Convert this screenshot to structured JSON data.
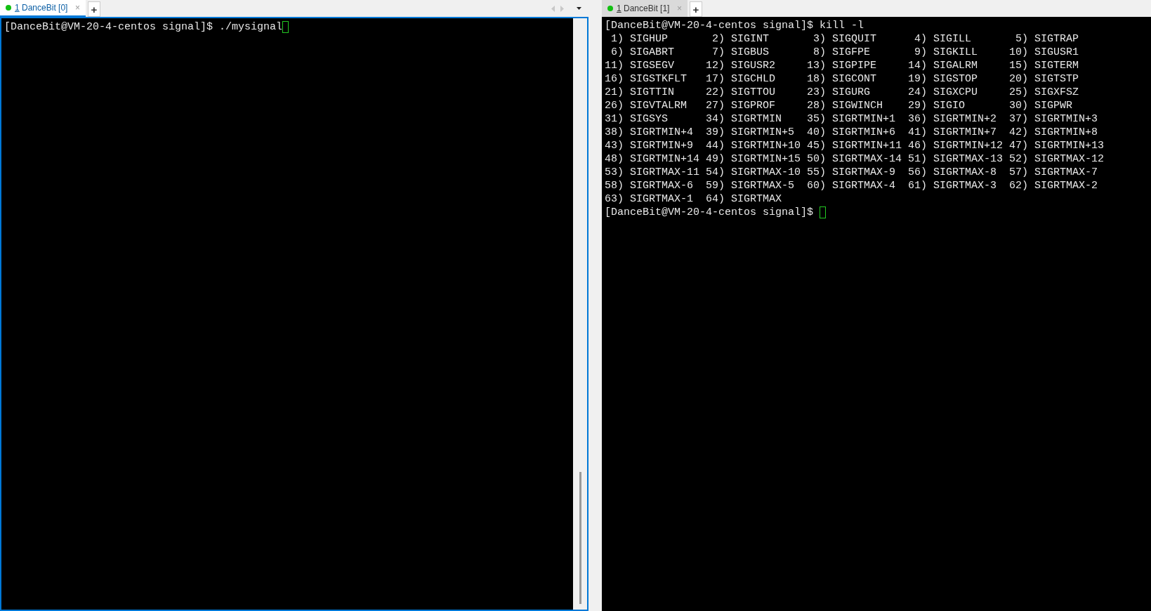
{
  "panes": [
    {
      "tab": {
        "number": "1",
        "label": "DanceBit [0]",
        "selected": true,
        "close": "×"
      },
      "new_tab": "+",
      "lines": [
        "[DanceBit@VM-20-4-centos signal]$ ./mysignal"
      ],
      "cursor": true
    },
    {
      "tab": {
        "number": "1",
        "label": "DanceBit [1]",
        "selected": false,
        "close": "×"
      },
      "new_tab": "+",
      "lines": [
        "[DanceBit@VM-20-4-centos signal]$ kill -l",
        " 1) SIGHUP       2) SIGINT       3) SIGQUIT      4) SIGILL       5) SIGTRAP",
        " 6) SIGABRT      7) SIGBUS       8) SIGFPE       9) SIGKILL     10) SIGUSR1",
        "11) SIGSEGV     12) SIGUSR2     13) SIGPIPE     14) SIGALRM     15) SIGTERM",
        "16) SIGSTKFLT   17) SIGCHLD     18) SIGCONT     19) SIGSTOP     20) SIGTSTP",
        "21) SIGTTIN     22) SIGTTOU     23) SIGURG      24) SIGXCPU     25) SIGXFSZ",
        "26) SIGVTALRM   27) SIGPROF     28) SIGWINCH    29) SIGIO       30) SIGPWR",
        "31) SIGSYS      34) SIGRTMIN    35) SIGRTMIN+1  36) SIGRTMIN+2  37) SIGRTMIN+3",
        "38) SIGRTMIN+4  39) SIGRTMIN+5  40) SIGRTMIN+6  41) SIGRTMIN+7  42) SIGRTMIN+8",
        "43) SIGRTMIN+9  44) SIGRTMIN+10 45) SIGRTMIN+11 46) SIGRTMIN+12 47) SIGRTMIN+13",
        "48) SIGRTMIN+14 49) SIGRTMIN+15 50) SIGRTMAX-14 51) SIGRTMAX-13 52) SIGRTMAX-12",
        "53) SIGRTMAX-11 54) SIGRTMAX-10 55) SIGRTMAX-9  56) SIGRTMAX-8  57) SIGRTMAX-7",
        "58) SIGRTMAX-6  59) SIGRTMAX-5  60) SIGRTMAX-4  61) SIGRTMAX-3  62) SIGRTMAX-2",
        "63) SIGRTMAX-1  64) SIGRTMAX",
        "[DanceBit@VM-20-4-centos signal]$"
      ],
      "cursor": true
    }
  ]
}
